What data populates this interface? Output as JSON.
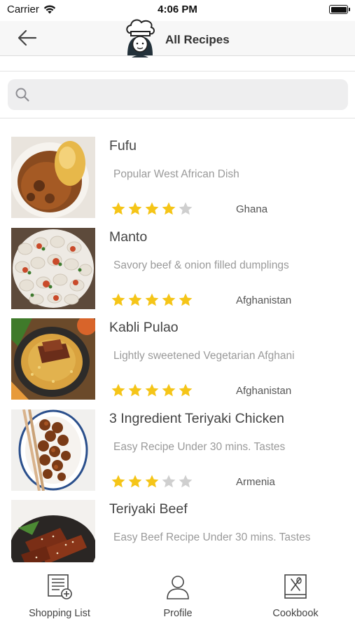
{
  "status_bar": {
    "carrier": "Carrier",
    "time": "4:06 PM"
  },
  "nav": {
    "title": "All Recipes",
    "back_icon": "arrow-left-icon",
    "logo": "chef-avatar-logo"
  },
  "search": {
    "placeholder": "",
    "value": "",
    "icon": "search-icon"
  },
  "recipes": [
    {
      "name": "Fufu",
      "description": "Popular West African Dish",
      "rating": 4,
      "country": "Ghana"
    },
    {
      "name": "Manto",
      "description": "Savory beef & onion filled dumplings",
      "rating": 5,
      "country": "Afghanistan"
    },
    {
      "name": "Kabli Pulao",
      "description": "Lightly sweetened Vegetarian Afghani",
      "rating": 5,
      "country": "Afghanistan"
    },
    {
      "name": "3 Ingredient Teriyaki Chicken",
      "description": "Easy Recipe Under 30 mins. Tastes",
      "rating": 3,
      "country": "Armenia"
    },
    {
      "name": "Teriyaki Beef",
      "description": "Easy Beef Recipe Under 30 mins. Tastes",
      "rating": null,
      "country": ""
    }
  ],
  "rating_max": 5,
  "colors": {
    "star_filled": "#f5c518",
    "star_empty": "#cfcfcf"
  },
  "tabs": [
    {
      "label": "Shopping List",
      "icon": "shopping-list-icon"
    },
    {
      "label": "Profile",
      "icon": "profile-icon"
    },
    {
      "label": "Cookbook",
      "icon": "cookbook-icon"
    }
  ]
}
